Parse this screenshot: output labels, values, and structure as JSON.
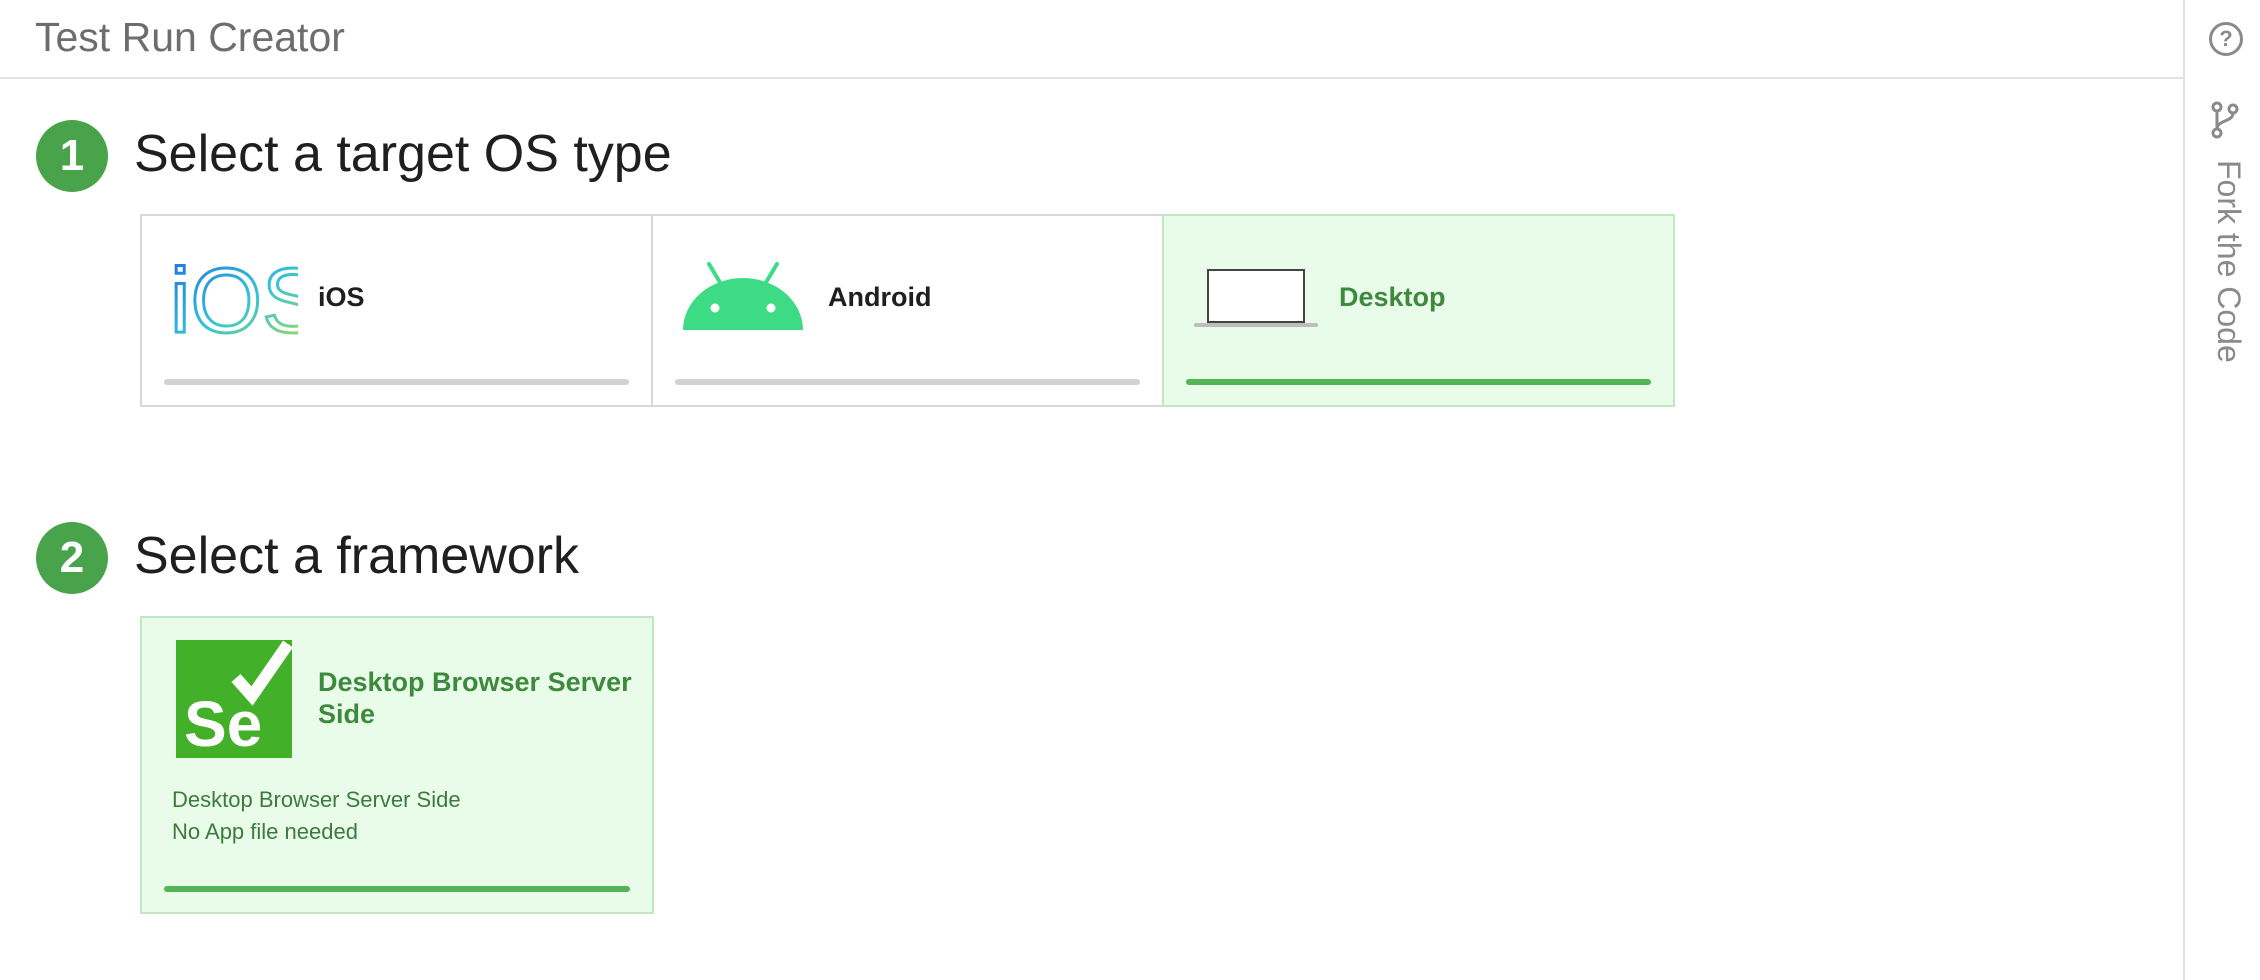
{
  "header": {
    "title": "Test Run Creator"
  },
  "sidebar": {
    "help_label": "?",
    "fork_label": "Fork the Code"
  },
  "steps": [
    {
      "number": "1",
      "title": "Select a target OS type"
    },
    {
      "number": "2",
      "title": "Select a framework"
    }
  ],
  "os_options": [
    {
      "label": "iOS",
      "logo_text": "iOS",
      "selected": false
    },
    {
      "label": "Android",
      "selected": false
    },
    {
      "label": "Desktop",
      "selected": true
    }
  ],
  "framework": {
    "logo_text": "Se",
    "title": "Desktop Browser Server Side",
    "description_line1": "Desktop Browser Server Side",
    "description_line2": "No App file needed",
    "selected": true
  },
  "colors": {
    "accent_green": "#49a34a",
    "selected_bg": "#e9fbe9",
    "selenium_green": "#43b02a",
    "android_green": "#3ddc84"
  }
}
